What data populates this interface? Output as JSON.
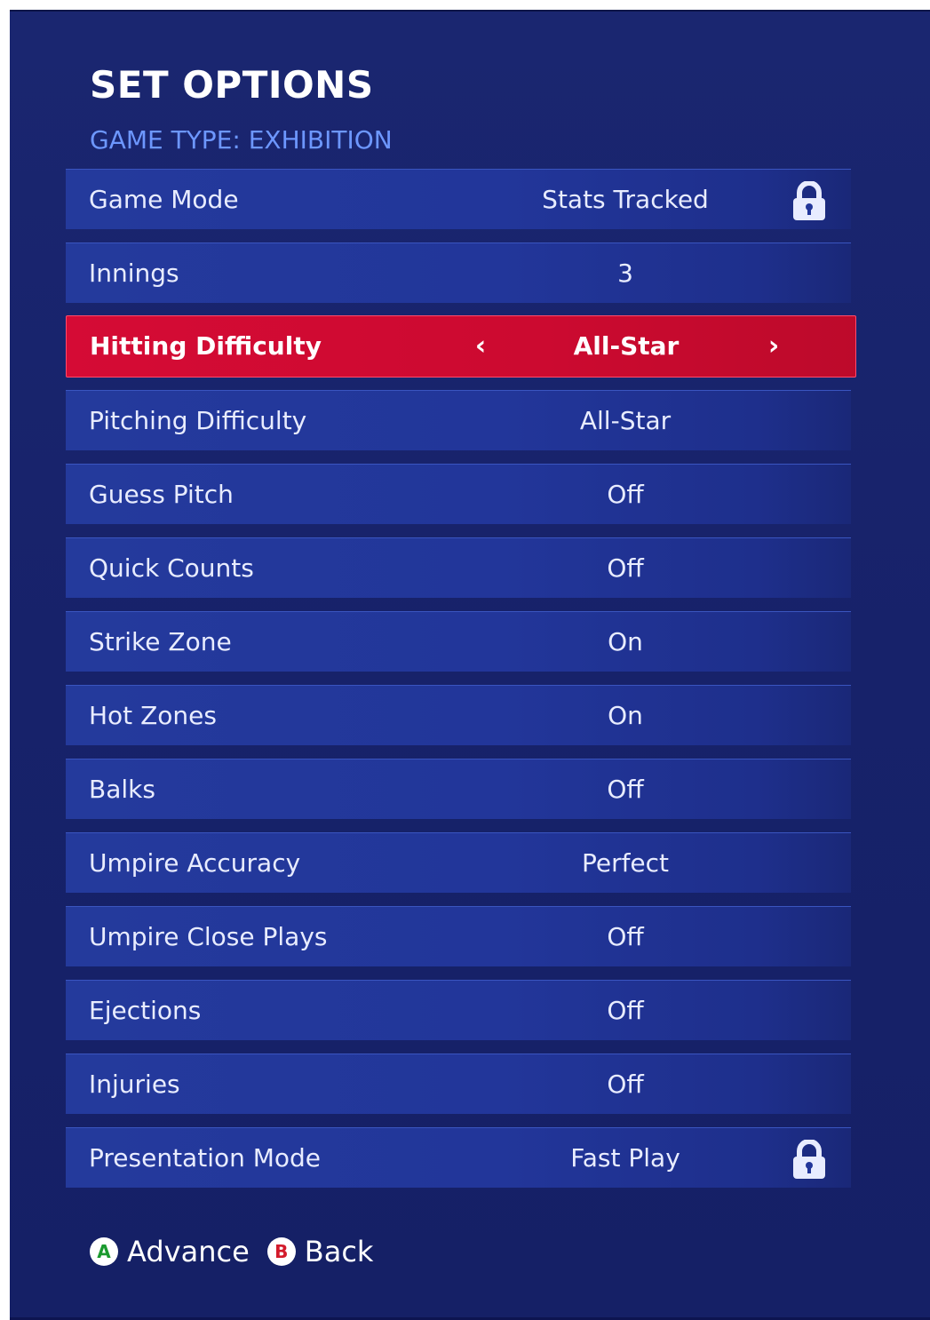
{
  "header": {
    "title": "SET OPTIONS",
    "subtitle": "GAME TYPE: EXHIBITION"
  },
  "options": [
    {
      "label": "Game Mode",
      "value": "Stats Tracked",
      "locked": true
    },
    {
      "label": "Innings",
      "value": "3"
    },
    {
      "label": "Hitting Difficulty",
      "value": "All-Star",
      "selected": true
    },
    {
      "label": "Pitching Difficulty",
      "value": "All-Star"
    },
    {
      "label": "Guess Pitch",
      "value": "Off"
    },
    {
      "label": "Quick Counts",
      "value": "Off"
    },
    {
      "label": "Strike Zone",
      "value": "On"
    },
    {
      "label": "Hot Zones",
      "value": "On"
    },
    {
      "label": "Balks",
      "value": "Off"
    },
    {
      "label": "Umpire Accuracy",
      "value": "Perfect"
    },
    {
      "label": "Umpire Close Plays",
      "value": "Off"
    },
    {
      "label": "Ejections",
      "value": "Off"
    },
    {
      "label": "Injuries",
      "value": "Off"
    },
    {
      "label": "Presentation Mode",
      "value": "Fast Play",
      "locked": true
    }
  ],
  "selector": {
    "left_arrow": "‹",
    "right_arrow": "›"
  },
  "footer": {
    "advance_button": "A",
    "advance_label": "Advance",
    "back_button": "B",
    "back_label": "Back"
  },
  "icons": {
    "lock": "lock-icon",
    "left": "chevron-left-icon",
    "right": "chevron-right-icon"
  },
  "colors": {
    "background": "#17226a",
    "row": "#22369a",
    "selected_row": "#cc0a30",
    "subtitle": "#6d97ff",
    "button_a": "#1b9a2e",
    "button_b": "#d31b2b"
  }
}
